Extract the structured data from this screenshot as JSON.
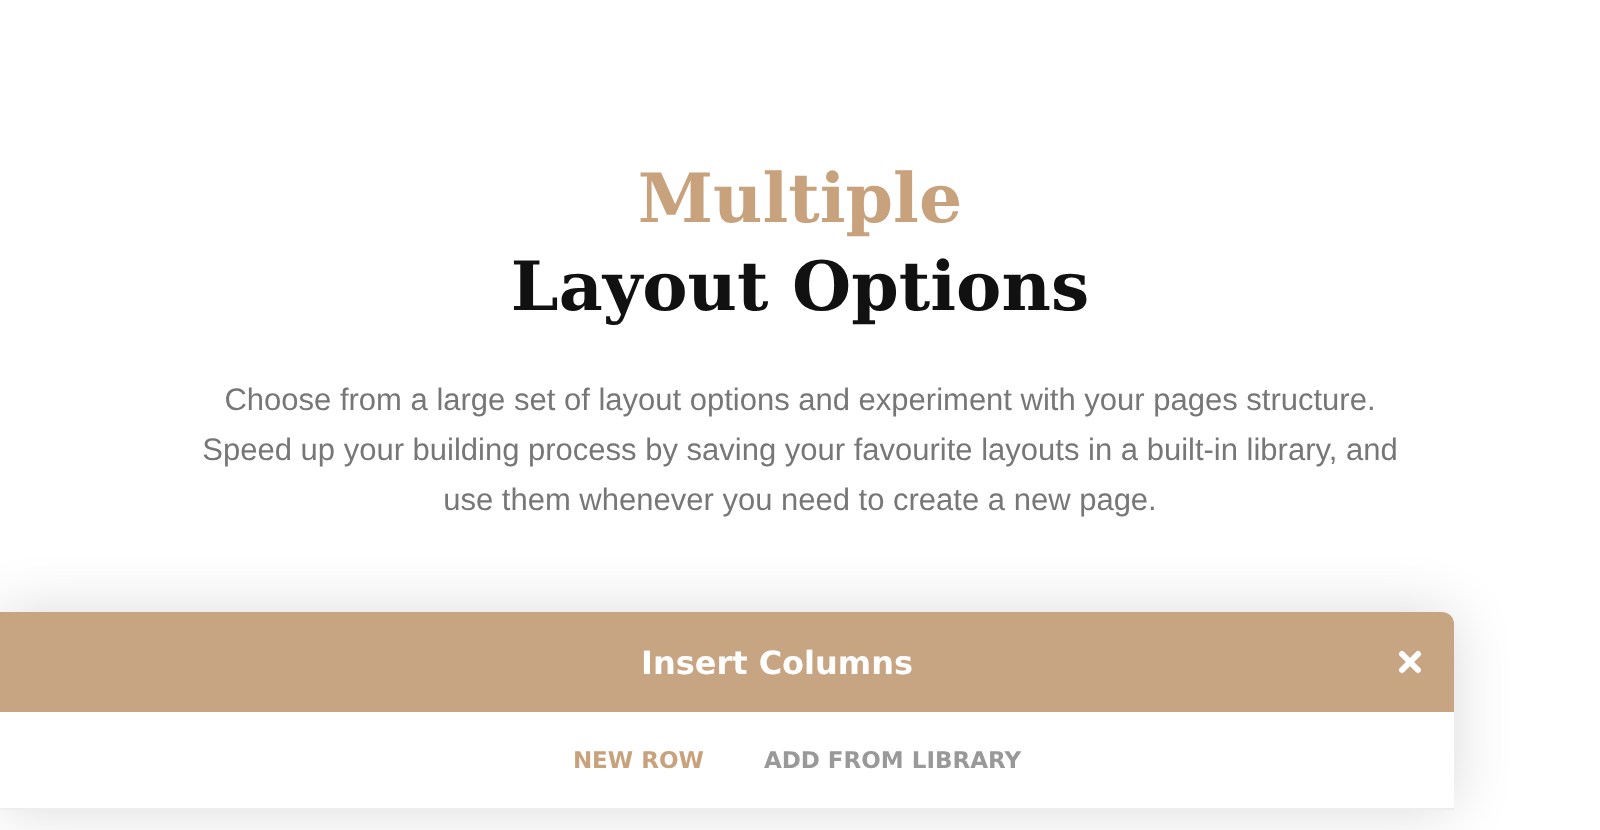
{
  "heading": {
    "accent": "Multiple",
    "title": "Layout Options"
  },
  "description": "Choose from a large set of layout options and experiment with your pages structure. Speed up your building process by saving your favourite layouts in a built-in library, and use them whenever you need to create a new page.",
  "modal": {
    "title": "Insert Columns",
    "tabs": [
      {
        "label": "NEW ROW",
        "selected": true
      },
      {
        "label": "ADD FROM LIBRARY",
        "selected": false
      }
    ]
  }
}
